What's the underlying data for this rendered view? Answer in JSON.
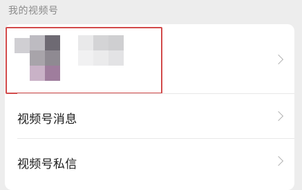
{
  "section": {
    "title": "我的视频号"
  },
  "account": {
    "name": "",
    "avatar_icon": "avatar-blurred-icon",
    "chevron_icon": "chevron-right-icon",
    "highlight_color": "#d24a4a"
  },
  "menu": {
    "items": [
      {
        "label": "视频号消息",
        "icon": "chevron-right-icon"
      },
      {
        "label": "视频号私信",
        "icon": "chevron-right-icon"
      }
    ]
  }
}
